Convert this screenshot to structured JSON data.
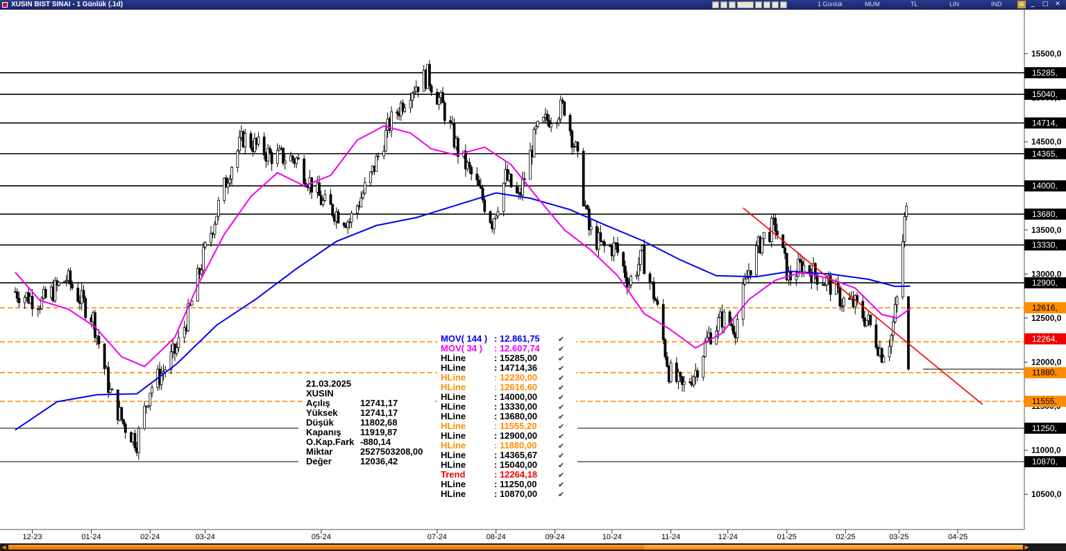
{
  "window": {
    "title": "XUSIN BIST SINAI - 1 Günlük (.1d)",
    "toolbar_labels": [
      "1 Günlük",
      "MUM",
      "TL",
      "LIN",
      "IND"
    ]
  },
  "info_box": {
    "date": "21.03.2025",
    "symbol": "XUSIN",
    "rows": [
      {
        "label": "Açılış",
        "value": "12741,17"
      },
      {
        "label": "Yüksek",
        "value": "12741,17"
      },
      {
        "label": "Düşük",
        "value": "11802,68"
      },
      {
        "label": "Kapanış",
        "value": "11919,87"
      },
      {
        "label": "O.Kap.Fark",
        "value": "-880,14"
      },
      {
        "label": "Miktar",
        "value": "2527503208,00"
      },
      {
        "label": "Değer",
        "value": "12036,42"
      }
    ]
  },
  "legend": [
    {
      "name": "MOV( 144 )",
      "value": ": 12.861,75",
      "color": "#0000ee"
    },
    {
      "name": "MOV( 34 )",
      "value": ": 12.607,74",
      "color": "#ee00ee"
    },
    {
      "name": "HLine",
      "value": ": 15285,00",
      "color": "#000000"
    },
    {
      "name": "HLine",
      "value": ": 14714,36",
      "color": "#000000"
    },
    {
      "name": "HLine",
      "value": ": 12230,00",
      "color": "#ff8c00"
    },
    {
      "name": "HLine",
      "value": ": 12616,60",
      "color": "#ff8c00"
    },
    {
      "name": "HLine",
      "value": ": 14000,00",
      "color": "#000000"
    },
    {
      "name": "HLine",
      "value": ": 13330,00",
      "color": "#000000"
    },
    {
      "name": "HLine",
      "value": ": 13680,00",
      "color": "#000000"
    },
    {
      "name": "HLine",
      "value": ": 11555,20",
      "color": "#ff8c00"
    },
    {
      "name": "HLine",
      "value": ": 12900,00",
      "color": "#000000"
    },
    {
      "name": "HLine",
      "value": ": 11880,00",
      "color": "#ff8c00"
    },
    {
      "name": "HLine",
      "value": ": 14365,67",
      "color": "#000000"
    },
    {
      "name": "HLine",
      "value": ": 15040,00",
      "color": "#000000"
    },
    {
      "name": "Trend",
      "value": ": 12264,18",
      "color": "#ee0000"
    },
    {
      "name": "HLine",
      "value": ": 11250,00",
      "color": "#000000"
    },
    {
      "name": "HLine",
      "value": ": 10870,00",
      "color": "#000000"
    }
  ],
  "chart_data": {
    "type": "candlestick",
    "x_tick_labels": [
      "12-23",
      "01-24",
      "02-24",
      "03-24",
      "05-24",
      "07-24",
      "08-24",
      "09-24",
      "10-24",
      "11-24",
      "12-24",
      "01-25",
      "02-25",
      "03-25",
      "04-25"
    ],
    "y_tick_labels": [
      "15500,0",
      "15000,0",
      "14500,0",
      "14000,0",
      "13500,0",
      "13000,0",
      "12500,0",
      "12000,0",
      "11500,0",
      "11000,0",
      "10500,0"
    ],
    "y_ticks": [
      15500,
      15000,
      14500,
      14000,
      13500,
      13000,
      12500,
      12000,
      11500,
      11000,
      10500
    ],
    "y_range": [
      10100,
      16000
    ],
    "hlines": [
      {
        "value": 15285,
        "label": "15285,",
        "style": "solid",
        "color": "#000000"
      },
      {
        "value": 15040,
        "label": "15040,",
        "style": "solid",
        "color": "#000000"
      },
      {
        "value": 14714.36,
        "label": "14714,",
        "style": "solid",
        "color": "#000000"
      },
      {
        "value": 14365.67,
        "label": "14365,",
        "style": "solid",
        "color": "#000000"
      },
      {
        "value": 14000,
        "label": "14000,",
        "style": "solid",
        "color": "#000000"
      },
      {
        "value": 13680,
        "label": "13680,",
        "style": "solid",
        "color": "#000000"
      },
      {
        "value": 13330,
        "label": "13330,",
        "style": "solid",
        "color": "#000000"
      },
      {
        "value": 12900,
        "label": "12900,",
        "style": "solid",
        "color": "#000000"
      },
      {
        "value": 12616.6,
        "label": "12616,",
        "style": "dashed",
        "color": "#ff8c00"
      },
      {
        "value": 12230,
        "label": "",
        "style": "dashed",
        "color": "#ff8c00"
      },
      {
        "value": 11880,
        "label": "11880,",
        "style": "dashed",
        "color": "#ff8c00"
      },
      {
        "value": 11555.2,
        "label": "11555,",
        "style": "dashed",
        "color": "#ff8c00"
      },
      {
        "value": 11250,
        "label": "11250,",
        "style": "solid",
        "color": "#000000"
      },
      {
        "value": 10870,
        "label": "10870,",
        "style": "solid",
        "color": "#000000"
      }
    ],
    "trend_label": {
      "value": 12264.18,
      "label": "12264,",
      "color": "#ee0000"
    },
    "trend_line": {
      "start": {
        "x": "2024-12-23",
        "y": 13750
      },
      "end": {
        "x": "2025-04-28",
        "y": 11520
      },
      "color": "#ee0000"
    },
    "ma_144": {
      "name": "MOV( 144 )",
      "color": "#0000ee",
      "points": [
        [
          "2023-12-06",
          11230
        ],
        [
          "2023-12-28",
          11550
        ],
        [
          "2024-01-18",
          11630
        ],
        [
          "2024-02-08",
          11640
        ],
        [
          "2024-02-29",
          11980
        ],
        [
          "2024-03-21",
          12420
        ],
        [
          "2024-04-11",
          12720
        ],
        [
          "2024-05-02",
          13060
        ],
        [
          "2024-05-23",
          13370
        ],
        [
          "2024-06-13",
          13550
        ],
        [
          "2024-07-04",
          13640
        ],
        [
          "2024-07-25",
          13780
        ],
        [
          "2024-08-15",
          13920
        ],
        [
          "2024-09-02",
          13860
        ],
        [
          "2024-09-23",
          13730
        ],
        [
          "2024-10-11",
          13560
        ],
        [
          "2024-10-31",
          13380
        ],
        [
          "2024-11-20",
          13160
        ],
        [
          "2024-12-09",
          12980
        ],
        [
          "2024-12-30",
          12970
        ],
        [
          "2025-01-17",
          13030
        ],
        [
          "2025-02-07",
          13000
        ],
        [
          "2025-02-27",
          12940
        ],
        [
          "2025-03-13",
          12860
        ],
        [
          "2025-03-21",
          12862
        ]
      ]
    },
    "ma_34": {
      "name": "MOV( 34 )",
      "color": "#ee00ee",
      "points": [
        [
          "2023-12-06",
          13020
        ],
        [
          "2023-12-19",
          12700
        ],
        [
          "2024-01-03",
          12600
        ],
        [
          "2024-01-17",
          12400
        ],
        [
          "2024-01-31",
          12060
        ],
        [
          "2024-02-12",
          11950
        ],
        [
          "2024-02-28",
          12280
        ],
        [
          "2024-03-11",
          12870
        ],
        [
          "2024-03-25",
          13450
        ],
        [
          "2024-04-08",
          13880
        ],
        [
          "2024-04-22",
          14150
        ],
        [
          "2024-05-06",
          14000
        ],
        [
          "2024-05-20",
          14120
        ],
        [
          "2024-06-03",
          14520
        ],
        [
          "2024-06-17",
          14680
        ],
        [
          "2024-07-01",
          14600
        ],
        [
          "2024-07-12",
          14420
        ],
        [
          "2024-07-25",
          14350
        ],
        [
          "2024-08-09",
          14440
        ],
        [
          "2024-08-23",
          14240
        ],
        [
          "2024-09-06",
          13860
        ],
        [
          "2024-09-20",
          13500
        ],
        [
          "2024-10-04",
          13270
        ],
        [
          "2024-10-18",
          12980
        ],
        [
          "2024-11-01",
          12550
        ],
        [
          "2024-11-14",
          12380
        ],
        [
          "2024-11-28",
          12160
        ],
        [
          "2024-12-12",
          12330
        ],
        [
          "2024-12-26",
          12710
        ],
        [
          "2025-01-09",
          12930
        ],
        [
          "2025-01-23",
          13020
        ],
        [
          "2025-02-06",
          12950
        ],
        [
          "2025-02-20",
          12840
        ],
        [
          "2025-03-06",
          12540
        ],
        [
          "2025-03-14",
          12500
        ],
        [
          "2025-03-21",
          12608
        ]
      ]
    },
    "candles_note": "Daily OHLC candles approximated from the chart; last candle 21.03.2025 O 12741,17 H 12741,17 L 11802,68 C 11919,87",
    "close_path": [
      [
        "2023-12-06",
        12800
      ],
      [
        "2023-12-20",
        12680
      ],
      [
        "2024-01-02",
        12950
      ],
      [
        "2024-01-16",
        12500
      ],
      [
        "2024-01-25",
        11650
      ],
      [
        "2024-02-01",
        11300
      ],
      [
        "2024-02-08",
        11100
      ],
      [
        "2024-02-15",
        11700
      ],
      [
        "2024-02-22",
        11900
      ],
      [
        "2024-02-29",
        12150
      ],
      [
        "2024-03-07",
        12600
      ],
      [
        "2024-03-14",
        13200
      ],
      [
        "2024-03-21",
        13700
      ],
      [
        "2024-03-28",
        14200
      ],
      [
        "2024-04-04",
        14550
      ],
      [
        "2024-04-18",
        14350
      ],
      [
        "2024-05-02",
        14300
      ],
      [
        "2024-05-16",
        13800
      ],
      [
        "2024-05-30",
        13600
      ],
      [
        "2024-06-10",
        14100
      ],
      [
        "2024-06-20",
        14700
      ],
      [
        "2024-07-01",
        15100
      ],
      [
        "2024-07-10",
        15250
      ],
      [
        "2024-07-18",
        14900
      ],
      [
        "2024-07-26",
        14400
      ],
      [
        "2024-08-05",
        14000
      ],
      [
        "2024-08-13",
        13600
      ],
      [
        "2024-08-20",
        14100
      ],
      [
        "2024-08-27",
        13850
      ],
      [
        "2024-09-05",
        14600
      ],
      [
        "2024-09-13",
        14800
      ],
      [
        "2024-09-20",
        14900
      ],
      [
        "2024-09-26",
        14400
      ],
      [
        "2024-10-03",
        13500
      ],
      [
        "2024-10-10",
        13300
      ],
      [
        "2024-10-17",
        13300
      ],
      [
        "2024-10-24",
        12900
      ],
      [
        "2024-10-31",
        13200
      ],
      [
        "2024-11-07",
        12700
      ],
      [
        "2024-11-14",
        11900
      ],
      [
        "2024-11-21",
        11700
      ],
      [
        "2024-11-28",
        11900
      ],
      [
        "2024-12-05",
        12300
      ],
      [
        "2024-12-12",
        12500
      ],
      [
        "2024-12-19",
        12400
      ],
      [
        "2024-12-26",
        13050
      ],
      [
        "2025-01-02",
        13400
      ],
      [
        "2025-01-09",
        13550
      ],
      [
        "2025-01-16",
        12950
      ],
      [
        "2025-01-23",
        13100
      ],
      [
        "2025-01-30",
        13000
      ],
      [
        "2025-02-06",
        12900
      ],
      [
        "2025-02-13",
        12700
      ],
      [
        "2025-02-20",
        12650
      ],
      [
        "2025-02-27",
        12450
      ],
      [
        "2025-03-06",
        12100
      ],
      [
        "2025-03-11",
        12300
      ],
      [
        "2025-03-14",
        12700
      ],
      [
        "2025-03-18",
        13600
      ],
      [
        "2025-03-19",
        13700
      ],
      [
        "2025-03-20",
        12800
      ],
      [
        "2025-03-21",
        11920
      ]
    ]
  }
}
